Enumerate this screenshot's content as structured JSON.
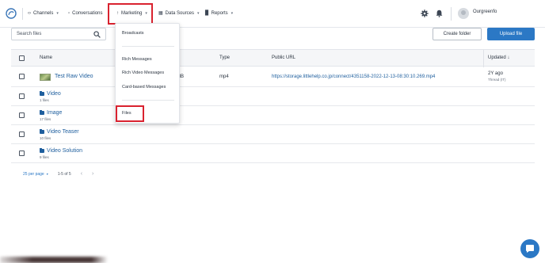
{
  "nav": {
    "items": [
      {
        "label": "Channels",
        "icon": "code-brackets-icon"
      },
      {
        "label": "Conversations",
        "icon": "chat-bubble-icon"
      },
      {
        "label": "Marketing",
        "icon": "broadcast-tower-icon"
      },
      {
        "label": "Data Sources",
        "icon": "grid-icon"
      },
      {
        "label": "Reports",
        "icon": "bar-chart-icon"
      }
    ],
    "user_name": "Ourgreenfo",
    "highlight_color": "#d9222f"
  },
  "toolbar": {
    "search_placeholder": "Search files",
    "create_folder_label": "Create folder",
    "upload_file_label": "Upload file"
  },
  "table": {
    "columns": {
      "name": "Name",
      "type": "Type",
      "public_url": "Public URL",
      "updated": "Updated ↓"
    },
    "file_rows": [
      {
        "name": "Test Raw Video",
        "size": "MB",
        "type": "mp4",
        "url": "https://storage.littlehelp.co.jp/connect/4351158-2022-12-13-08:30:10.269.mp4",
        "updated": "2Y ago",
        "updated_sub": "Thread (IT)"
      }
    ],
    "folder_rows": [
      {
        "name": "Video",
        "count": "1 files"
      },
      {
        "name": "Image",
        "count": "17 files"
      },
      {
        "name": "Video Teaser",
        "count": "10 files"
      },
      {
        "name": "Video Solution",
        "count": "9 files"
      }
    ]
  },
  "pagination": {
    "per_page": "25 per page",
    "range": "1-5 of 5",
    "prev": "‹",
    "next": "›"
  },
  "marketing_menu": {
    "items": [
      "Broadcasts",
      "Rich Messages",
      "Rich Video Messages",
      "Card-based Messages",
      "Files"
    ]
  },
  "colors": {
    "accent": "#2b78c5",
    "link": "#1f5f9e"
  }
}
